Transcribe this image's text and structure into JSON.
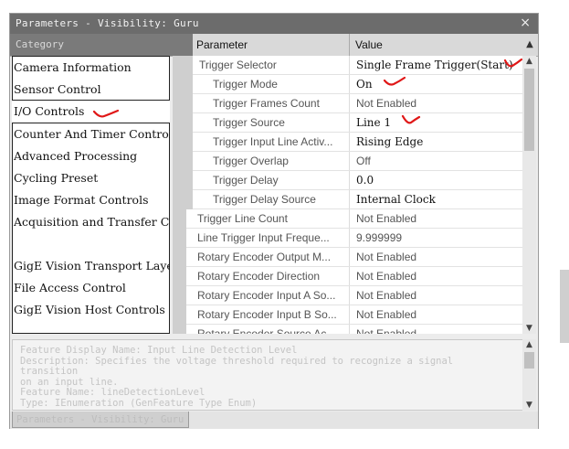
{
  "window": {
    "title": "Parameters - Visibility: Guru",
    "close_glyph": "×"
  },
  "header": {
    "category": "Category",
    "parameter": "Parameter",
    "value": "Value",
    "scroll_glyph": "▲"
  },
  "categories": [
    "Camera Information",
    "Sensor Control",
    "I/O Controls",
    "Counter And Timer Control",
    "Advanced Processing",
    "Cycling Preset",
    "Image Format Controls",
    "Acquisition and Transfer Co...",
    "GigE Vision Transport Layer",
    "File Access Control",
    "GigE Vision Host Controls"
  ],
  "parameters": [
    {
      "name": "Trigger Selector",
      "value": "Single Frame Trigger(Start)"
    },
    {
      "name": "Trigger Mode",
      "value": "On"
    },
    {
      "name": "Trigger Frames Count",
      "value": "Not Enabled"
    },
    {
      "name": "Trigger Source",
      "value": "Line 1"
    },
    {
      "name": "Trigger Input Line Activ...",
      "value": "Rising Edge"
    },
    {
      "name": "Trigger Overlap",
      "value": "Off"
    },
    {
      "name": "Trigger Delay",
      "value": "0.0"
    },
    {
      "name": "Trigger Delay Source",
      "value": "Internal Clock"
    },
    {
      "name": "Trigger Line Count",
      "value": "Not Enabled"
    },
    {
      "name": "Line Trigger Input Freque...",
      "value": "9.999999"
    },
    {
      "name": "Rotary Encoder Output M...",
      "value": "Not Enabled"
    },
    {
      "name": "Rotary Encoder Direction",
      "value": "Not Enabled"
    },
    {
      "name": "Rotary Encoder Input A So...",
      "value": "Not Enabled"
    },
    {
      "name": "Rotary Encoder Input B So...",
      "value": "Not Enabled"
    },
    {
      "name": "Rotary Encoder Source Ac...",
      "value": "Not Enabled"
    }
  ],
  "description": {
    "line1": "Feature Display Name: Input Line Detection Level",
    "line2": "Description: Specifies the voltage threshold required to recognize a signal transition",
    "line3": "on an input line.",
    "line4": "Feature Name: lineDetectionLevel",
    "line5": "Type: IEnumeration (GenFeature Type Enum)"
  },
  "statusbar": {
    "tab_label": "Parameters - Visibility: Guru"
  },
  "scrollbar": {
    "up_glyph": "▲",
    "down_glyph": "▼"
  },
  "colors": {
    "annotation_red": "#e01818",
    "titlebar": "#6c6c6c"
  }
}
